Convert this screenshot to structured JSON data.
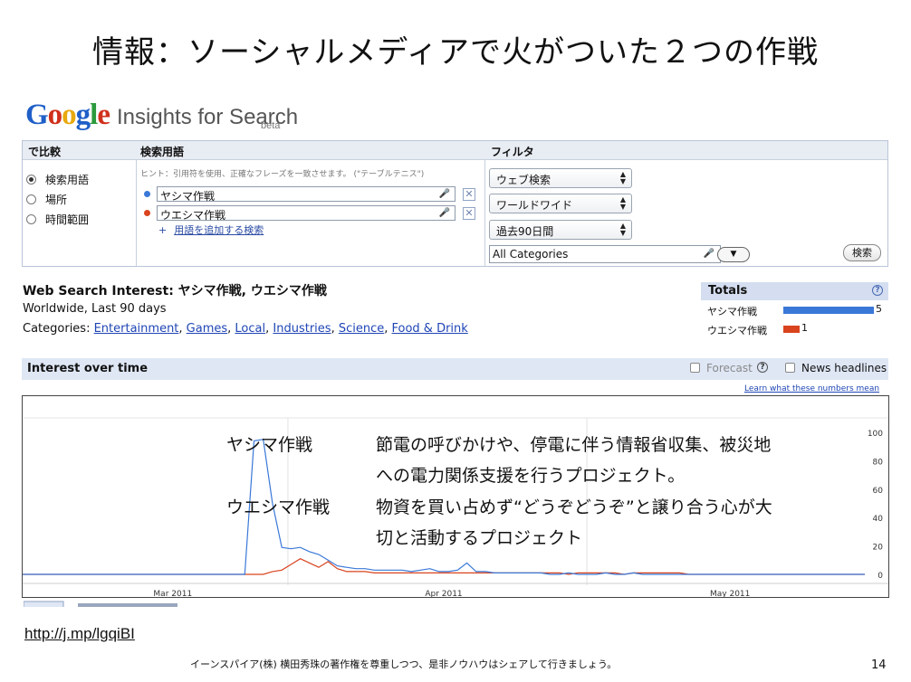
{
  "slide": {
    "title": "情報：ソーシャルメディアで火がついた２つの作戦",
    "url": "http://j.mp/lgqiBI",
    "footer": "イーンスパイア(株) 横田秀珠の著作権を尊重しつつ、是非ノウハウはシェアして行きましょう。",
    "page_number": "14"
  },
  "logo": {
    "letters": [
      "G",
      "o",
      "o",
      "g",
      "l",
      "e"
    ],
    "product": "Insights for Search",
    "beta": "beta"
  },
  "compare": {
    "headers": [
      "で比較",
      "検索用語",
      "フィルタ"
    ],
    "options": [
      {
        "label": "検索用語",
        "selected": true
      },
      {
        "label": "場所",
        "selected": false
      },
      {
        "label": "時間範囲",
        "selected": false
      }
    ],
    "hint": "ヒント：引用符を使用、正確なフレーズを一致させます。 (\"テーブルテニス\")",
    "terms": [
      {
        "value": "ヤシマ作戦",
        "color": "#3a78d8"
      },
      {
        "value": "ウエシマ作戦",
        "color": "#d9431e"
      }
    ],
    "remove_glyph": "✕",
    "mic_glyph": "🎤",
    "add_plus": "+",
    "add_term": "用語を追加する検索"
  },
  "filters": {
    "search_type": "ウェブ検索",
    "region": "ワールドワイド",
    "period": "過去90日間",
    "category": "All Categories",
    "search_button": "検索",
    "arrow_up": "▲",
    "arrow_down": "▼"
  },
  "results": {
    "title_prefix": "Web Search Interest:",
    "title_terms": "ヤシマ作戦, ウエシマ作戦",
    "scope": "Worldwide, Last 90 days",
    "categories_label": "Categories:",
    "categories": [
      "Entertainment",
      "Games",
      "Local",
      "Industries",
      "Science",
      "Food & Drink"
    ]
  },
  "totals": {
    "title": "Totals",
    "help": "?",
    "rows": [
      {
        "label": "ヤシマ作戦",
        "value": 5,
        "color": "#3a78d8"
      },
      {
        "label": "ウエシマ作戦",
        "value": 1,
        "color": "#d9431e"
      }
    ]
  },
  "interest": {
    "title": "Interest over time",
    "forecast": "Forecast",
    "forecast_help": "?",
    "news_headlines": "News headlines",
    "learn_link": "Learn what these numbers mean"
  },
  "chart_data": {
    "type": "line",
    "x_labels": [
      "Mar 2011",
      "Apr 2011",
      "May 2011"
    ],
    "ylim": [
      0,
      100
    ],
    "y_ticks": [
      0,
      20,
      40,
      60,
      80,
      100
    ],
    "series": [
      {
        "name": "ヤシマ作戦",
        "color": "#3a78d8",
        "values": [
          0,
          0,
          0,
          0,
          0,
          0,
          0,
          0,
          0,
          0,
          0,
          0,
          0,
          0,
          0,
          0,
          0,
          0,
          0,
          0,
          0,
          0,
          0,
          0,
          0,
          94,
          95,
          50,
          19,
          18,
          19,
          16,
          14,
          10,
          6,
          5,
          4,
          4,
          3,
          3,
          3,
          3,
          2,
          3,
          4,
          2,
          2,
          3,
          8,
          2,
          2,
          1,
          1,
          1,
          1,
          1,
          1,
          0,
          0,
          1,
          0,
          0,
          0,
          1,
          0,
          0,
          1,
          0,
          0,
          0,
          0,
          0,
          0,
          0,
          0,
          0,
          0,
          0,
          0,
          0,
          0,
          0,
          0,
          0,
          0,
          0,
          0,
          0,
          0,
          0,
          0,
          0
        ]
      },
      {
        "name": "ウエシマ作戦",
        "color": "#d9431e",
        "values": [
          0,
          0,
          0,
          0,
          0,
          0,
          0,
          0,
          0,
          0,
          0,
          0,
          0,
          0,
          0,
          0,
          0,
          0,
          0,
          0,
          0,
          0,
          0,
          0,
          0,
          0,
          0,
          2,
          3,
          7,
          11,
          8,
          5,
          9,
          4,
          2,
          2,
          2,
          1,
          1,
          1,
          1,
          1,
          1,
          1,
          1,
          1,
          1,
          1,
          1,
          1,
          1,
          1,
          1,
          1,
          1,
          1,
          1,
          1,
          0,
          1,
          1,
          1,
          1,
          1,
          0,
          1,
          1,
          1,
          1,
          1,
          1,
          0,
          0,
          0,
          0,
          0,
          0,
          0,
          0,
          0,
          0,
          0,
          0,
          0,
          0,
          0,
          0,
          0,
          0,
          0,
          0
        ]
      }
    ]
  },
  "overlay": {
    "items": [
      {
        "name": "ヤシマ作戦",
        "lines": [
          "節電の呼びかけや、停電に伴う情報省収集、被災地",
          "への電力関係支援を行うプロジェクト。"
        ]
      },
      {
        "name": "ウエシマ作戦",
        "lines": [
          "物資を買い占めず“どうぞどうぞ”と譲り合う心が大",
          "切と活動するプロジェクト"
        ]
      }
    ]
  }
}
